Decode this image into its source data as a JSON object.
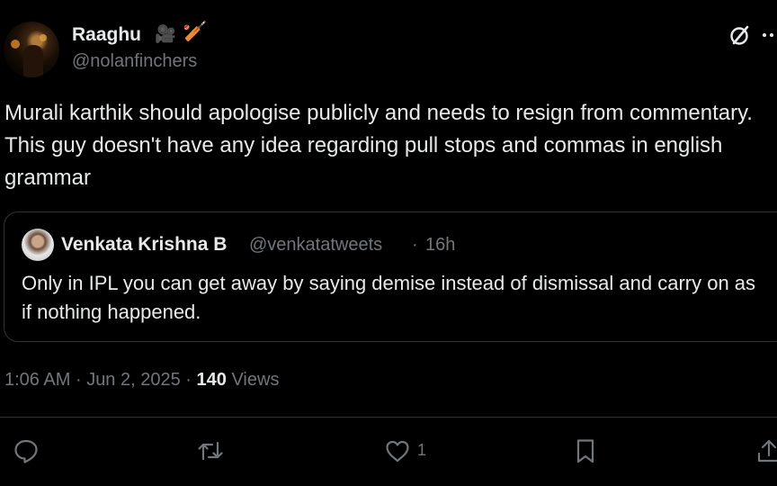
{
  "author": {
    "display_name": "Raaghu",
    "handle": "@nolanfinchers",
    "badges": [
      "🎥",
      "🏏"
    ]
  },
  "tweet": {
    "text": "Murali karthik should apologise publicly and needs to resign from commentary. This guy doesn't have any idea regarding pull stops and commas in english grammar"
  },
  "quoted": {
    "display_name": "Venkata Krishna B",
    "handle": "@venkatatweets",
    "separator": "·",
    "time": "16h",
    "text": "Only in IPL you can get away by saying demise instead of dismissal and carry on as if nothing happened."
  },
  "meta": {
    "time": "1:06 AM",
    "dot1": "·",
    "date": "Jun 2, 2025",
    "dot2": "·",
    "views_count": "140",
    "views_label": "Views"
  },
  "actions": {
    "like_count": "1"
  },
  "icons": {
    "header": [
      "grok-icon",
      "more-icon"
    ],
    "actions": [
      "reply-icon",
      "repost-icon",
      "like-icon",
      "bookmark-icon",
      "share-icon"
    ]
  },
  "colors": {
    "background": "#000000",
    "text": "#e7e9ea",
    "secondary": "#71767b",
    "border": "#2f3336"
  }
}
